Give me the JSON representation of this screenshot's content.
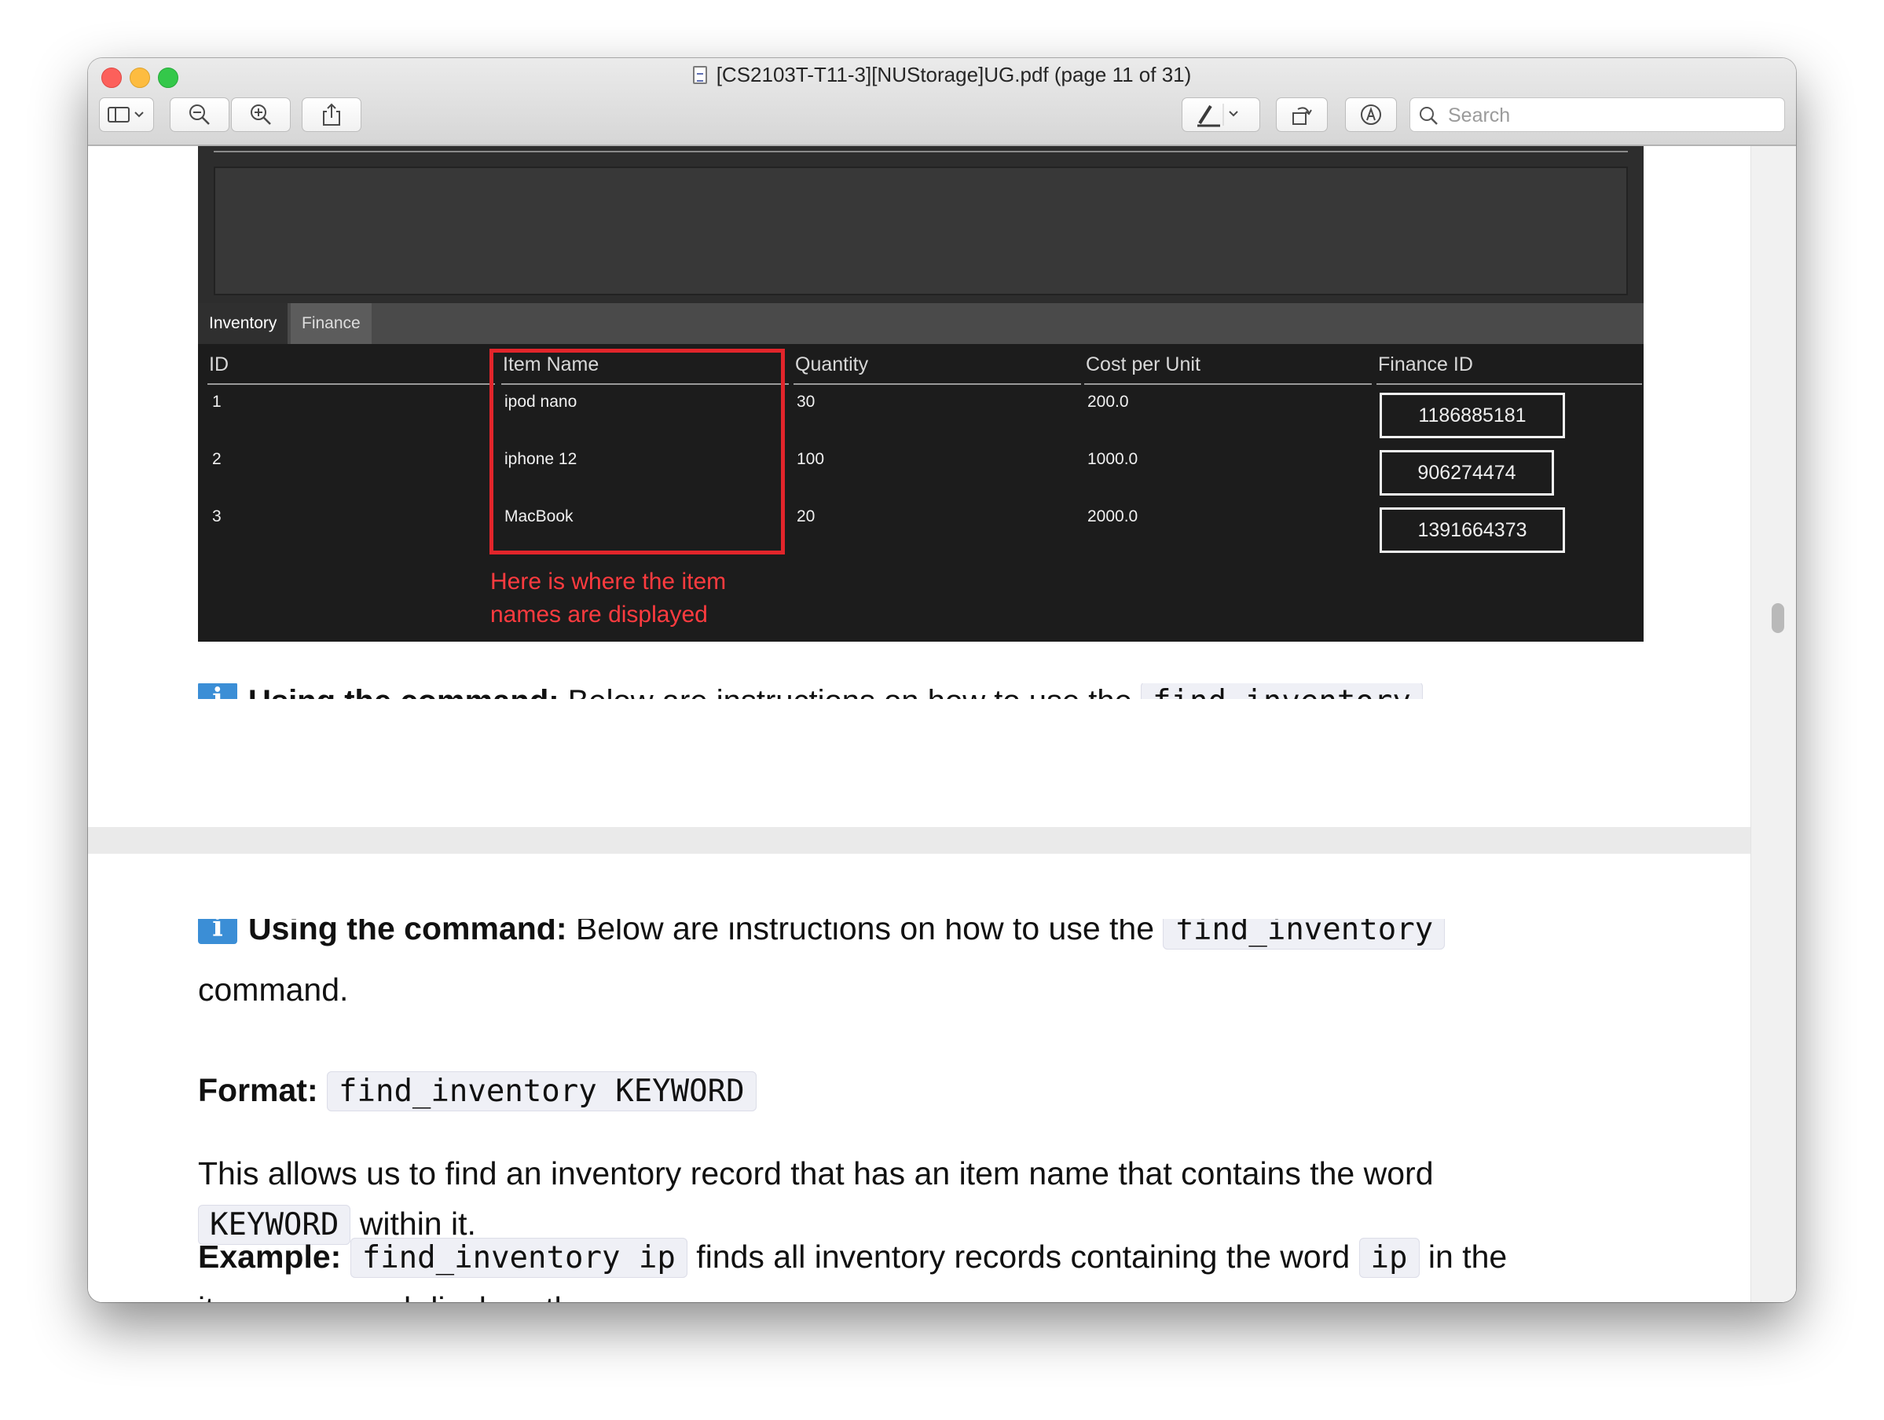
{
  "window": {
    "title": "[CS2103T-T11-3][NUStorage]UG.pdf (page 11 of 31)"
  },
  "toolbar": {
    "search_placeholder": "Search"
  },
  "screenshot": {
    "tabs": [
      "Inventory",
      "Finance"
    ],
    "columns": [
      "ID",
      "Item Name",
      "Quantity",
      "Cost per Unit",
      "Finance ID"
    ],
    "rows": [
      {
        "id": "1",
        "name": "ipod nano",
        "qty": "30",
        "cost": "200.0",
        "fid": "1186885181"
      },
      {
        "id": "2",
        "name": "iphone 12",
        "qty": "100",
        "cost": "1000.0",
        "fid": "906274474"
      },
      {
        "id": "3",
        "name": "MacBook",
        "qty": "20",
        "cost": "2000.0",
        "fid": "1391664373"
      }
    ],
    "annotation_line1": "Here is where the item",
    "annotation_line2": "names are displayed",
    "highlight_color": "#e2252b"
  },
  "doc": {
    "using_label": "Using the command:",
    "using_text": "Below are instructions on how to use the",
    "using_code": "find_inventory",
    "using_tail": "command.",
    "format_label": "Format:",
    "format_code": "find_inventory KEYWORD",
    "allows_text": "This allows us to find an inventory record that has an item name that contains the word",
    "allows_code": "KEYWORD",
    "allows_tail": "within it.",
    "example_label": "Example:",
    "example_code": "find_inventory ip",
    "example_text": "finds all inventory records containing the word",
    "example_code2": "ip",
    "example_text2": "in the",
    "example_tail": "item name and displays them."
  }
}
